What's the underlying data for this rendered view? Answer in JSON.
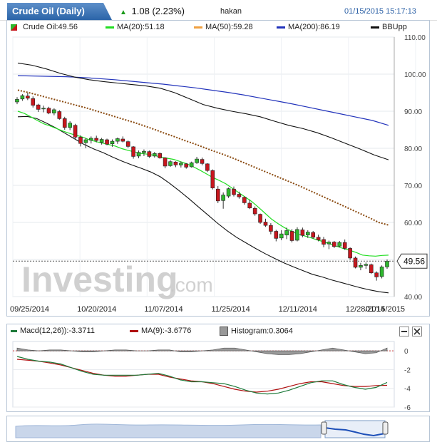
{
  "header": {
    "title": "Crude Oil (Daily)",
    "change": "1.08 (2.23%)",
    "user": "hakan",
    "datetime": "01/15/2015 15:17:13"
  },
  "main_legend": {
    "instrument": "Crude Oil:49.56",
    "ma20": "MA(20):51.18",
    "ma50": "MA(50):59.28",
    "ma200": "MA(200):86.19",
    "bb": "BBUpp"
  },
  "price_tag": "49.56",
  "watermark": {
    "word": "Investing",
    "suffix": ".com"
  },
  "macd_legend": {
    "macd": "Macd(12,26)):-3.3711",
    "signal": "MA(9):-3.6776",
    "hist": "Histogram:0.3064"
  },
  "colors": {
    "up": "#2db82d",
    "down": "#c8161d",
    "ma20": "#22dd22",
    "ma50": "#8a4a10",
    "ma200": "#2233bb",
    "bb": "#111111",
    "macd": "#1e7a3a",
    "signal": "#b01010"
  },
  "chart_data": [
    {
      "type": "candlestick",
      "title": "Crude Oil (Daily)",
      "ylim": [
        40,
        110
      ],
      "yticks": [
        40,
        50,
        60,
        70,
        80,
        90,
        100,
        110
      ],
      "xticks": [
        "09/25/2014",
        "10/20/2014",
        "11/07/2014",
        "11/25/2014",
        "12/11/2014",
        "12/28/2014",
        "01/15/2015"
      ],
      "candles": [
        {
          "o": 92.5,
          "h": 93.8,
          "l": 91.9,
          "c": 93.2
        },
        {
          "o": 93.3,
          "h": 94.6,
          "l": 92.8,
          "c": 94.2
        },
        {
          "o": 94.1,
          "h": 95.0,
          "l": 93.0,
          "c": 93.5
        },
        {
          "o": 93.4,
          "h": 94.0,
          "l": 91.0,
          "c": 91.6
        },
        {
          "o": 91.7,
          "h": 92.0,
          "l": 89.8,
          "c": 90.5
        },
        {
          "o": 90.6,
          "h": 91.5,
          "l": 89.7,
          "c": 90.8
        },
        {
          "o": 90.8,
          "h": 91.2,
          "l": 89.2,
          "c": 89.5
        },
        {
          "o": 89.5,
          "h": 90.8,
          "l": 88.9,
          "c": 90.4
        },
        {
          "o": 89.9,
          "h": 90.3,
          "l": 87.7,
          "c": 88.0
        },
        {
          "o": 88.0,
          "h": 88.5,
          "l": 85.0,
          "c": 85.6
        },
        {
          "o": 85.6,
          "h": 87.3,
          "l": 84.9,
          "c": 86.8
        },
        {
          "o": 86.2,
          "h": 86.6,
          "l": 82.5,
          "c": 83.0
        },
        {
          "o": 83.0,
          "h": 83.5,
          "l": 80.5,
          "c": 81.3
        },
        {
          "o": 81.5,
          "h": 82.8,
          "l": 80.0,
          "c": 82.3
        },
        {
          "o": 82.2,
          "h": 83.2,
          "l": 81.3,
          "c": 82.7
        },
        {
          "o": 82.7,
          "h": 83.4,
          "l": 81.6,
          "c": 82.1
        },
        {
          "o": 81.6,
          "h": 82.8,
          "l": 81.0,
          "c": 82.4
        },
        {
          "o": 82.3,
          "h": 82.6,
          "l": 80.8,
          "c": 81.1
        },
        {
          "o": 81.2,
          "h": 82.4,
          "l": 80.4,
          "c": 81.9
        },
        {
          "o": 81.9,
          "h": 82.9,
          "l": 81.2,
          "c": 82.6
        },
        {
          "o": 82.5,
          "h": 83.2,
          "l": 81.6,
          "c": 81.9
        },
        {
          "o": 81.8,
          "h": 82.1,
          "l": 80.1,
          "c": 80.5
        },
        {
          "o": 80.4,
          "h": 80.6,
          "l": 77.2,
          "c": 77.8
        },
        {
          "o": 77.9,
          "h": 79.4,
          "l": 77.3,
          "c": 78.9
        },
        {
          "o": 78.8,
          "h": 79.7,
          "l": 77.9,
          "c": 79.2
        },
        {
          "o": 79.1,
          "h": 79.4,
          "l": 77.4,
          "c": 77.8
        },
        {
          "o": 77.9,
          "h": 79.0,
          "l": 77.5,
          "c": 78.6
        },
        {
          "o": 78.6,
          "h": 78.9,
          "l": 77.2,
          "c": 77.4
        },
        {
          "o": 77.4,
          "h": 77.6,
          "l": 74.6,
          "c": 75.2
        },
        {
          "o": 75.3,
          "h": 76.8,
          "l": 75.0,
          "c": 76.4
        },
        {
          "o": 76.3,
          "h": 76.5,
          "l": 74.9,
          "c": 75.5
        },
        {
          "o": 75.5,
          "h": 76.4,
          "l": 74.8,
          "c": 76.0
        },
        {
          "o": 75.8,
          "h": 76.0,
          "l": 74.5,
          "c": 74.9
        },
        {
          "o": 75.0,
          "h": 76.4,
          "l": 74.8,
          "c": 76.1
        },
        {
          "o": 76.1,
          "h": 77.7,
          "l": 75.8,
          "c": 77.1
        },
        {
          "o": 77.0,
          "h": 77.5,
          "l": 75.4,
          "c": 75.9
        },
        {
          "o": 75.8,
          "h": 76.0,
          "l": 73.6,
          "c": 74.0
        },
        {
          "o": 74.0,
          "h": 74.3,
          "l": 68.9,
          "c": 69.3
        },
        {
          "o": 69.0,
          "h": 69.8,
          "l": 65.2,
          "c": 65.8
        },
        {
          "o": 65.9,
          "h": 68.1,
          "l": 63.7,
          "c": 67.4
        },
        {
          "o": 67.1,
          "h": 69.4,
          "l": 66.6,
          "c": 69.1
        },
        {
          "o": 69.0,
          "h": 69.7,
          "l": 67.0,
          "c": 67.5
        },
        {
          "o": 67.6,
          "h": 68.3,
          "l": 66.4,
          "c": 66.9
        },
        {
          "o": 66.8,
          "h": 67.0,
          "l": 64.8,
          "c": 65.3
        },
        {
          "o": 65.2,
          "h": 66.2,
          "l": 63.6,
          "c": 63.9
        },
        {
          "o": 63.8,
          "h": 64.3,
          "l": 61.8,
          "c": 62.3
        },
        {
          "o": 62.2,
          "h": 62.4,
          "l": 59.6,
          "c": 60.0
        },
        {
          "o": 60.1,
          "h": 61.0,
          "l": 58.8,
          "c": 59.2
        },
        {
          "o": 59.2,
          "h": 59.8,
          "l": 56.8,
          "c": 57.6
        },
        {
          "o": 57.6,
          "h": 58.0,
          "l": 54.9,
          "c": 55.7
        },
        {
          "o": 55.8,
          "h": 57.9,
          "l": 55.2,
          "c": 56.9
        },
        {
          "o": 56.6,
          "h": 58.6,
          "l": 55.5,
          "c": 57.8
        },
        {
          "o": 57.6,
          "h": 58.2,
          "l": 54.6,
          "c": 55.1
        },
        {
          "o": 55.2,
          "h": 58.7,
          "l": 54.9,
          "c": 58.1
        },
        {
          "o": 58.0,
          "h": 58.6,
          "l": 56.0,
          "c": 56.5
        },
        {
          "o": 56.6,
          "h": 57.9,
          "l": 55.8,
          "c": 57.4
        },
        {
          "o": 57.3,
          "h": 57.7,
          "l": 55.6,
          "c": 56.0
        },
        {
          "o": 56.0,
          "h": 56.7,
          "l": 54.9,
          "c": 55.3
        },
        {
          "o": 55.4,
          "h": 56.1,
          "l": 53.3,
          "c": 54.1
        },
        {
          "o": 54.2,
          "h": 55.1,
          "l": 52.8,
          "c": 54.7
        },
        {
          "o": 54.7,
          "h": 55.0,
          "l": 53.1,
          "c": 53.5
        },
        {
          "o": 53.6,
          "h": 55.0,
          "l": 53.3,
          "c": 54.6
        },
        {
          "o": 54.6,
          "h": 55.4,
          "l": 52.6,
          "c": 53.0
        },
        {
          "o": 53.0,
          "h": 53.3,
          "l": 49.9,
          "c": 50.4
        },
        {
          "o": 50.4,
          "h": 50.8,
          "l": 47.6,
          "c": 47.9
        },
        {
          "o": 47.9,
          "h": 49.1,
          "l": 47.1,
          "c": 48.4
        },
        {
          "o": 48.4,
          "h": 49.2,
          "l": 47.5,
          "c": 48.7
        },
        {
          "o": 48.6,
          "h": 48.9,
          "l": 46.1,
          "c": 46.4
        },
        {
          "o": 46.4,
          "h": 46.8,
          "l": 44.3,
          "c": 45.3
        },
        {
          "o": 45.4,
          "h": 48.4,
          "l": 44.9,
          "c": 48.0
        },
        {
          "o": 48.0,
          "h": 50.0,
          "l": 47.5,
          "c": 49.56
        }
      ],
      "series": [
        {
          "name": "MA(20)",
          "values": [
            90.0,
            89.4,
            88.5,
            87.5,
            86.6,
            86.0,
            85.3,
            84.6,
            84.0,
            83.5,
            83.0,
            82.3,
            81.8,
            81.4,
            81.0,
            80.6,
            79.9,
            79.4,
            79.0,
            78.6,
            78.4,
            78.1,
            77.6,
            77.3,
            77.0,
            76.4,
            75.8,
            75.0,
            74.1,
            73.1,
            72.1,
            71.3,
            70.4,
            69.2,
            68.0,
            66.8,
            65.6,
            64.1,
            62.5,
            60.9,
            59.7,
            58.6,
            57.7,
            56.9,
            56.4,
            55.9,
            55.3,
            54.8,
            54.2,
            53.6,
            53.0,
            52.5,
            51.9,
            51.2,
            51.0,
            50.9,
            51.1,
            51.18
          ]
        },
        {
          "name": "MA(50)",
          "values": [
            95.7,
            95.1,
            94.4,
            93.7,
            93.0,
            92.3,
            91.6,
            90.9,
            90.1,
            89.3,
            88.5,
            87.7,
            86.9,
            86.0,
            85.1,
            84.1,
            83.2,
            82.2,
            81.3,
            80.3,
            79.3,
            78.4,
            77.4,
            76.3,
            75.2,
            74.1,
            73.0,
            71.9,
            70.8,
            69.7,
            68.5,
            67.3,
            66.1,
            64.9,
            63.7,
            62.5,
            61.3,
            60.0,
            59.28
          ]
        },
        {
          "name": "MA(200)",
          "values": [
            99.6,
            99.5,
            99.4,
            99.3,
            99.1,
            98.8,
            98.5,
            98.1,
            97.7,
            97.3,
            96.8,
            96.3,
            95.7,
            95.1,
            94.4,
            93.6,
            92.8,
            92.0,
            91.1,
            90.2,
            89.3,
            88.4,
            87.5,
            86.19
          ]
        },
        {
          "name": "BB upper",
          "values": [
            103.0,
            102.4,
            101.4,
            100.2,
            99.2,
            98.5,
            98.0,
            97.6,
            97.2,
            96.8,
            96.2,
            95.0,
            93.4,
            91.8,
            90.8,
            90.0,
            89.3,
            88.5,
            87.3,
            86.2,
            85.3,
            84.2,
            82.8,
            81.3,
            79.8,
            78.2,
            76.9
          ]
        },
        {
          "name": "BB lower",
          "values": [
            88.5,
            88.6,
            88.0,
            86.8,
            85.5,
            84.0,
            82.5,
            81.0,
            79.8,
            78.8,
            77.6,
            76.5,
            75.5,
            74.6,
            73.6,
            72.3,
            70.5,
            68.5,
            66.4,
            64.2,
            62.0,
            59.8,
            57.8,
            56.0,
            54.5,
            53.0,
            51.6,
            50.3,
            49.1,
            48.0,
            47.0,
            46.0,
            45.3,
            44.5,
            43.8,
            43.1,
            42.4,
            41.8,
            41.3,
            41.0
          ]
        }
      ],
      "last_value": 49.56
    },
    {
      "type": "line",
      "title": "Macd(12,26))",
      "ylim": [
        -6,
        1
      ],
      "yticks": [
        0,
        -2,
        -4,
        -6
      ],
      "series": [
        {
          "name": "Macd(12,26))",
          "values": [
            -0.6,
            -0.9,
            -1.1,
            -1.2,
            -1.4,
            -1.8,
            -2.2,
            -2.5,
            -2.6,
            -2.6,
            -2.6,
            -2.6,
            -2.5,
            -2.4,
            -2.7,
            -3.1,
            -3.3,
            -3.3,
            -3.4,
            -3.5,
            -3.8,
            -4.2,
            -4.5,
            -4.6,
            -4.5,
            -4.2,
            -3.8,
            -3.4,
            -3.2,
            -3.2,
            -3.6,
            -3.9,
            -4.1,
            -3.9,
            -3.3711
          ]
        },
        {
          "name": "MA(9)",
          "values": [
            -0.9,
            -1.0,
            -1.1,
            -1.3,
            -1.5,
            -1.8,
            -2.1,
            -2.4,
            -2.6,
            -2.7,
            -2.7,
            -2.6,
            -2.5,
            -2.5,
            -2.8,
            -3.0,
            -3.2,
            -3.3,
            -3.5,
            -3.8,
            -4.1,
            -4.3,
            -4.4,
            -4.3,
            -4.1,
            -3.8,
            -3.5,
            -3.3,
            -3.3,
            -3.5,
            -3.7,
            -3.8,
            -3.8,
            -3.7,
            -3.6776
          ]
        },
        {
          "name": "Histogram",
          "values": [
            0.3,
            0.1,
            0.0,
            0.1,
            0.1,
            0.0,
            -0.1,
            -0.1,
            0.0,
            0.1,
            0.1,
            0.0,
            0.0,
            0.1,
            0.1,
            -0.1,
            -0.1,
            0.0,
            0.1,
            0.3,
            0.3,
            0.1,
            -0.1,
            -0.3,
            -0.4,
            -0.4,
            -0.3,
            -0.1,
            0.1,
            0.3,
            0.1,
            -0.1,
            -0.3,
            -0.2,
            0.3064
          ]
        }
      ]
    }
  ]
}
